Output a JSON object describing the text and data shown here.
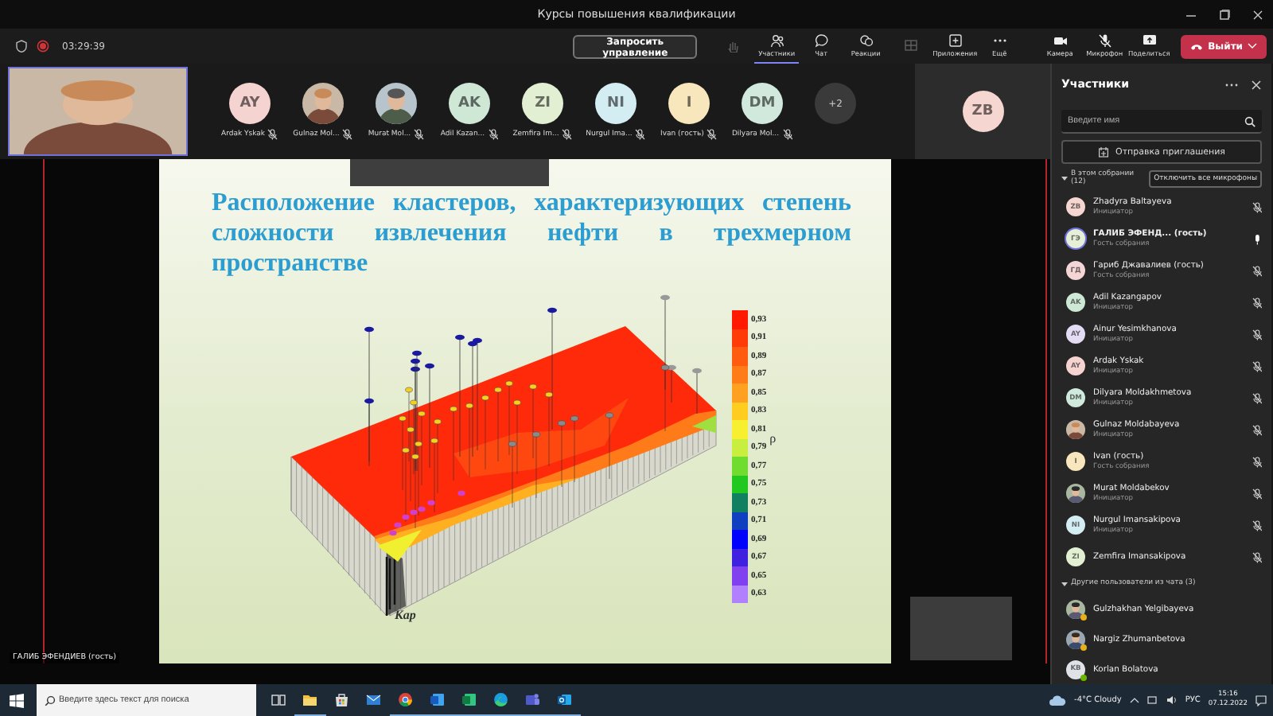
{
  "window": {
    "title": "Курсы повышения квалификации"
  },
  "meeting_bar": {
    "timer": "03:29:39",
    "request_button": "Запросить управление",
    "tools": [
      {
        "kind": "hand",
        "selected": false,
        "disabled": true
      },
      {
        "kind": "people",
        "label": "Участники",
        "selected": true,
        "disabled": false
      },
      {
        "kind": "chat",
        "label": "Чат",
        "selected": false,
        "disabled": false
      },
      {
        "kind": "reactions",
        "label": "Реакции",
        "selected": false,
        "disabled": false
      },
      {
        "kind": "rooms",
        "selected": false,
        "disabled": true
      },
      {
        "kind": "apps",
        "label": "Приложения",
        "selected": false,
        "disabled": false
      },
      {
        "kind": "more",
        "label": "Ещё",
        "selected": false,
        "disabled": false
      },
      {
        "kind": "camera",
        "label": "Камера",
        "selected": false,
        "disabled": false
      },
      {
        "kind": "mic",
        "label": "Микрофон",
        "selected": false,
        "disabled": false
      },
      {
        "kind": "share",
        "label": "Поделиться",
        "selected": false,
        "disabled": false
      }
    ],
    "leave_button": "Выйти"
  },
  "gallery": [
    {
      "kind": "initials",
      "initials": "AY",
      "name": "Ardak Yskak",
      "color": "#f5d3d0"
    },
    {
      "name": "Gulnaz Mol..."
    },
    {
      "name": "Murat Mol..."
    },
    {
      "kind": "initials",
      "initials": "AK",
      "name": "Adil Kazan...",
      "color": "#cfe8d6"
    },
    {
      "kind": "initials",
      "initials": "ZI",
      "name": "Zemfira Im...",
      "color": "#e2efd2"
    },
    {
      "kind": "initials",
      "initials": "NI",
      "name": "Nurgul Ima...",
      "color": "#d3edf3"
    },
    {
      "kind": "initials",
      "initials": "I",
      "name": "Ivan (гость)",
      "color": "#f8e6bd"
    },
    {
      "kind": "initials",
      "initials": "DM",
      "name": "Dilyara Mol...",
      "color": "#d0e9dc"
    }
  ],
  "overflow_count": "+2",
  "side_tile": {
    "initials": "ZB",
    "color": "#f6d6d0"
  },
  "presenter_label": "ГАЛИБ ЭФЕНДИЕВ (гость)",
  "slide": {
    "title": "Расположение кластеров, характеризующих степень сложности извлечения нефти в трехмерном пространстве",
    "axis_label": "Кар",
    "legend_title": "ρ",
    "legend": [
      {
        "label": "0,93",
        "color": "#ff1a00"
      },
      {
        "label": "0,91",
        "color": "#ff3c08"
      },
      {
        "label": "0,89",
        "color": "#ff5c10"
      },
      {
        "label": "0,87",
        "color": "#ff7c18"
      },
      {
        "label": "0,85",
        "color": "#ffa020"
      },
      {
        "label": "0,83",
        "color": "#ffcc20"
      },
      {
        "label": "0,81",
        "color": "#f6f030"
      },
      {
        "label": "0,79",
        "color": "#c8ee40"
      },
      {
        "label": "0,77",
        "color": "#70dc30"
      },
      {
        "label": "0,75",
        "color": "#20c820"
      },
      {
        "label": "0,73",
        "color": "#108060"
      },
      {
        "label": "0,71",
        "color": "#1040c0"
      },
      {
        "label": "0,69",
        "color": "#0000ff"
      },
      {
        "label": "0,67",
        "color": "#4020e0"
      },
      {
        "label": "0,65",
        "color": "#8040f0"
      },
      {
        "label": "0,63",
        "color": "#b080ff"
      }
    ]
  },
  "panel": {
    "title": "Участники",
    "search": {
      "placeholder": "Введите имя"
    },
    "invite_button": "Отправка приглашения",
    "in_meeting": {
      "label": "В этом собрании (12)",
      "expanded": true,
      "mute_all_button": "Отключить все микрофоны",
      "people": [
        {
          "kind": "initials",
          "initials": "ZB",
          "name": "Zhadyra Baltayeva",
          "role": "Инициатор",
          "color": "#f6d6d0",
          "muted": true
        },
        {
          "kind": "initials",
          "initials": "ГЭ",
          "name": "ГАЛИБ ЭФЕНД...",
          "tag": "(гость)",
          "role": "Гость собрания",
          "color": "#e6efd8",
          "muted": false
        },
        {
          "kind": "initials",
          "initials": "ГД",
          "name": "Гариб Джавалиев (гость)",
          "role": "Гость собрания",
          "color": "#f5d6d6",
          "muted": true
        },
        {
          "kind": "initials",
          "initials": "AK",
          "name": "Adil Kazangapov",
          "role": "Инициатор",
          "color": "#cfe8d6",
          "muted": true
        },
        {
          "kind": "initials",
          "initials": "AY",
          "name": "Ainur Yesimkhanova",
          "role": "Инициатор",
          "color": "#e4dcf3",
          "muted": true
        },
        {
          "kind": "initials",
          "initials": "AY",
          "name": "Ardak Yskak",
          "role": "Инициатор",
          "color": "#f5d3d0",
          "muted": true
        },
        {
          "kind": "initials",
          "initials": "DM",
          "name": "Dilyara Moldakhmetova",
          "role": "Инициатор",
          "color": "#d0e9dc",
          "muted": true
        },
        {
          "name": "Gulnaz Moldabayeva",
          "role": "Инициатор",
          "muted": true
        },
        {
          "kind": "initials",
          "initials": "I",
          "name": "Ivan (гость)",
          "role": "Гость собрания",
          "color": "#f8e6bd",
          "muted": true
        },
        {
          "name": "Murat Moldabekov",
          "role": "Инициатор",
          "muted": true
        },
        {
          "kind": "initials",
          "initials": "NI",
          "name": "Nurgul Imansakipova",
          "role": "Инициатор",
          "color": "#d3edf3",
          "muted": true
        },
        {
          "kind": "initials",
          "initials": "ZI",
          "name": "Zemfira Imansakipova",
          "color": "#e2efd2",
          "muted": true
        }
      ]
    },
    "chat_others": {
      "label": "Другие пользователи из чата (3)",
      "expanded": true,
      "people": [
        {
          "name": "Gulzhakhan Yelgibayeva",
          "color": "#e8b018"
        },
        {
          "name": "Nargiz Zhumanbetova",
          "color": "#e8b018"
        },
        {
          "kind": "initials",
          "initials": "KB",
          "name": "Korlan Bolatova",
          "color": "#6bb700"
        }
      ]
    }
  },
  "taskbar": {
    "search_placeholder": "Введите здесь текст для поиска",
    "apps": [
      {
        "kind": "taskview",
        "selected": false
      },
      {
        "kind": "folder",
        "selected": true
      },
      {
        "kind": "store",
        "selected": false
      },
      {
        "kind": "mail",
        "selected": false
      },
      {
        "kind": "chrome",
        "selected": true
      },
      {
        "kind": "word",
        "selected": true
      },
      {
        "kind": "excel",
        "selected": true
      },
      {
        "kind": "edge",
        "selected": true
      },
      {
        "kind": "teams",
        "selected": true
      },
      {
        "kind": "outlook",
        "selected": true
      }
    ],
    "weather": "-4°C  Cloudy",
    "language": "РУС",
    "time": "15:16",
    "date": "07.12.2022"
  }
}
